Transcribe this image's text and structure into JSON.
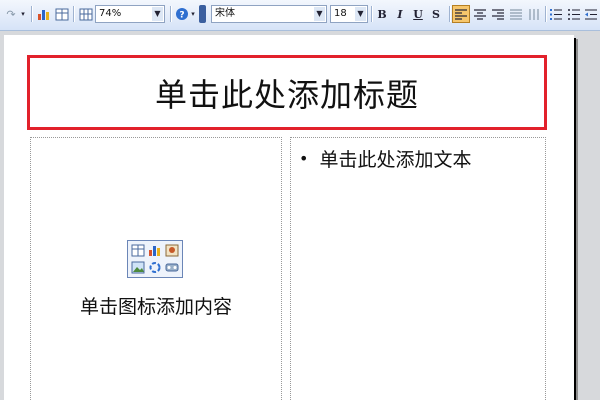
{
  "toolbar": {
    "zoom": "74%",
    "font_name": "宋体",
    "font_size": "18",
    "bold": "B",
    "italic": "I",
    "underline": "U",
    "shadow": "S",
    "help": "?"
  },
  "slide": {
    "title_placeholder": "单击此处添加标题",
    "text_placeholder": "单击此处添加文本",
    "bullet": "•",
    "content_placeholder": "单击图标添加内容"
  },
  "colors": {
    "title_border": "#e2212b",
    "toolbar_bg": "#d6e3f7",
    "active_button": "#f6c66c"
  }
}
